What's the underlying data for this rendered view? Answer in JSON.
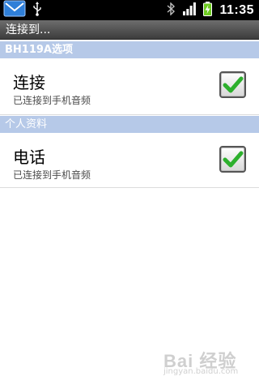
{
  "status_bar": {
    "time": "11:35",
    "icons": [
      "sms-icon",
      "usb-icon",
      "bluetooth-icon",
      "signal-icon",
      "battery-charging-icon"
    ]
  },
  "title_bar": {
    "title": "连接到..."
  },
  "sections": [
    {
      "header": "BH119A选项",
      "items": [
        {
          "title": "连接",
          "summary": "已连接到手机音频",
          "checked": true
        }
      ]
    },
    {
      "header": "个人资料",
      "items": [
        {
          "title": "电话",
          "summary": "已连接到手机音频",
          "checked": true
        }
      ]
    }
  ],
  "watermark": {
    "brand": "Bai 经验",
    "url": "jingyan.baidu.com"
  },
  "colors": {
    "section_header_bg": "#b6c9e8",
    "check_green": "#2db02d",
    "status_bar_bg": "#000000"
  }
}
